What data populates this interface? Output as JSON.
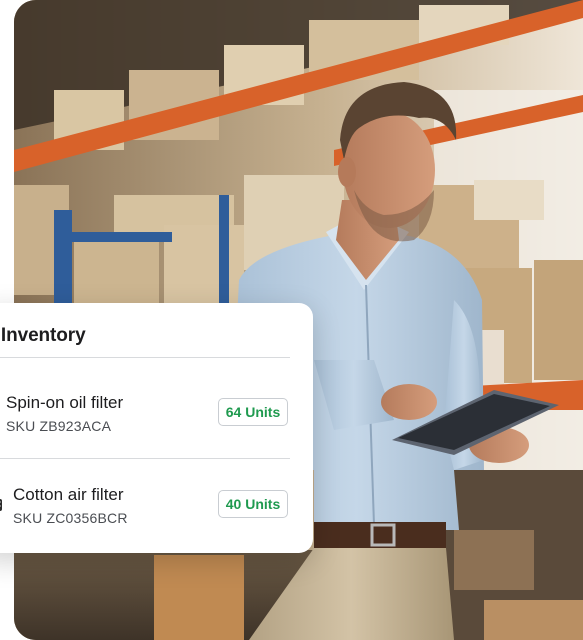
{
  "inventory_card": {
    "title": "nt Inventory",
    "items": [
      {
        "name": "Spin-on oil filter",
        "sku": "SKU ZB923ACA",
        "units": "64 Units"
      },
      {
        "name": "Cotton air filter",
        "sku": "SKU ZC0356BCR",
        "units": "40 Units"
      }
    ]
  },
  "colors": {
    "units_text": "#1f9a4f",
    "shelf_orange": "#d8622a",
    "rack_blue": "#2f5d9a",
    "shirt": "#b9cde0",
    "pants": "#c9b79a"
  },
  "icons": [
    "filter-icon"
  ]
}
